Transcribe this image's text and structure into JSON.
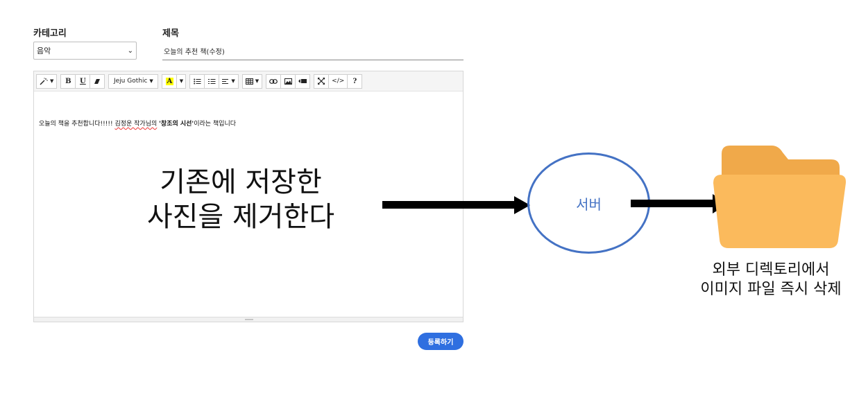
{
  "form": {
    "category_label": "카테고리",
    "category_value": "음악",
    "title_label": "제목",
    "title_value": "오늘의 추천 책(수정)"
  },
  "toolbar": {
    "font_name": "Jeju Gothic",
    "bold": "B",
    "underline": "U",
    "highlight": "A",
    "help": "?",
    "code": "</>"
  },
  "editor": {
    "content_part1": "오늘의 책을 추천합니다!!!!! ",
    "content_spell": "김정운 작가님의",
    "content_part2": " ",
    "content_bold": "'창조의 시선'",
    "content_part3": "이라는 책입니다"
  },
  "submit_label": "등록하기",
  "diagram": {
    "left_text_line1": "기존에 저장한",
    "left_text_line2": "사진을 제거한다",
    "server_label": "서버",
    "folder_caption_line1": "외부 디렉토리에서",
    "folder_caption_line2": "이미지 파일 즉시 삭제",
    "colors": {
      "server": "#4472c4",
      "folder_back": "#f0a94a",
      "folder_front": "#fbba5c",
      "submit": "#2f6fe0"
    }
  }
}
